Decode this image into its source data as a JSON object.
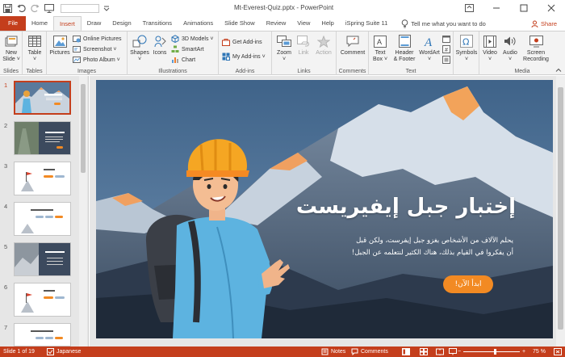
{
  "app": {
    "title": "Mt-Everest-Quiz.pptx  -  PowerPoint",
    "accent": "#c43e1c"
  },
  "qat": {
    "icons": [
      "save-icon",
      "undo-icon",
      "redo-icon",
      "slideshow-from-start-icon",
      "font-size-combo",
      "customize-icon"
    ]
  },
  "window_controls": {
    "icons": [
      "ribbon-display-icon",
      "minimize-icon",
      "restore-icon",
      "close-icon"
    ]
  },
  "tabs": [
    {
      "label": "File"
    },
    {
      "label": "Home"
    },
    {
      "label": "Insert",
      "active": true
    },
    {
      "label": "Draw"
    },
    {
      "label": "Design"
    },
    {
      "label": "Transitions"
    },
    {
      "label": "Animations"
    },
    {
      "label": "Slide Show"
    },
    {
      "label": "Review"
    },
    {
      "label": "View"
    },
    {
      "label": "Help"
    },
    {
      "label": "iSpring Suite 11"
    }
  ],
  "tell_me": "Tell me what you want to do",
  "share": "Share",
  "ribbon": {
    "slides": {
      "label": "Slides",
      "new_slide_1": "New",
      "new_slide_2": "Slide ˅"
    },
    "tables": {
      "label": "Tables",
      "table": "Table",
      "table_2": "˅"
    },
    "images": {
      "label": "Images",
      "pictures": "Pictures",
      "online_pictures": "Online Pictures",
      "screenshot": "Screenshot ˅",
      "photo_album": "Photo Album ˅"
    },
    "illustrations": {
      "label": "Illustrations",
      "shapes": "Shapes",
      "shapes_2": "˅",
      "icons": "Icons",
      "models": "3D Models ˅",
      "smartart": "SmartArt",
      "chart": "Chart"
    },
    "addins": {
      "label": "Add-ins",
      "get_addins": "Get Add-ins",
      "my_addins": "My Add-ins ˅"
    },
    "links": {
      "label": "Links",
      "zoom": "Zoom",
      "zoom_2": "˅",
      "link": "Link",
      "action": "Action"
    },
    "comments": {
      "label": "Comments",
      "comment": "Comment"
    },
    "text": {
      "label": "Text",
      "textbox_1": "Text",
      "textbox_2": "Box ˅",
      "header_1": "Header",
      "header_2": "& Footer",
      "wordart": "WordArt",
      "wordart_2": "˅"
    },
    "symbols": {
      "label": "",
      "symbols": "Symbols",
      "symbols_2": "˅"
    },
    "media": {
      "label": "Media",
      "video": "Video",
      "video_2": "˅",
      "audio": "Audio",
      "audio_2": "˅",
      "screen_1": "Screen",
      "screen_2": "Recording"
    }
  },
  "thumbnails": [
    {
      "num": "1",
      "active": true
    },
    {
      "num": "2"
    },
    {
      "num": "3"
    },
    {
      "num": "4"
    },
    {
      "num": "5"
    },
    {
      "num": "6"
    },
    {
      "num": "7"
    }
  ],
  "slide": {
    "title": "إختبار جبل إيفيريست",
    "body_line1": "يحلم الآلاف من الأشخاص بغزو جبل إيفرست، ولكن قبل",
    "body_line2": "أن يفكروا في القيام بذلك، هناك الكثير لنتعلمه عن الجبل!",
    "button": "ابدأ الآن!",
    "button_color": "#f28a23"
  },
  "status": {
    "slide_count": "Slide 1 of 19",
    "language": "Japanese",
    "notes": "Notes",
    "comments": "Comments",
    "zoom_value": "75 %",
    "zoom_minus": "−",
    "zoom_plus": "+"
  }
}
